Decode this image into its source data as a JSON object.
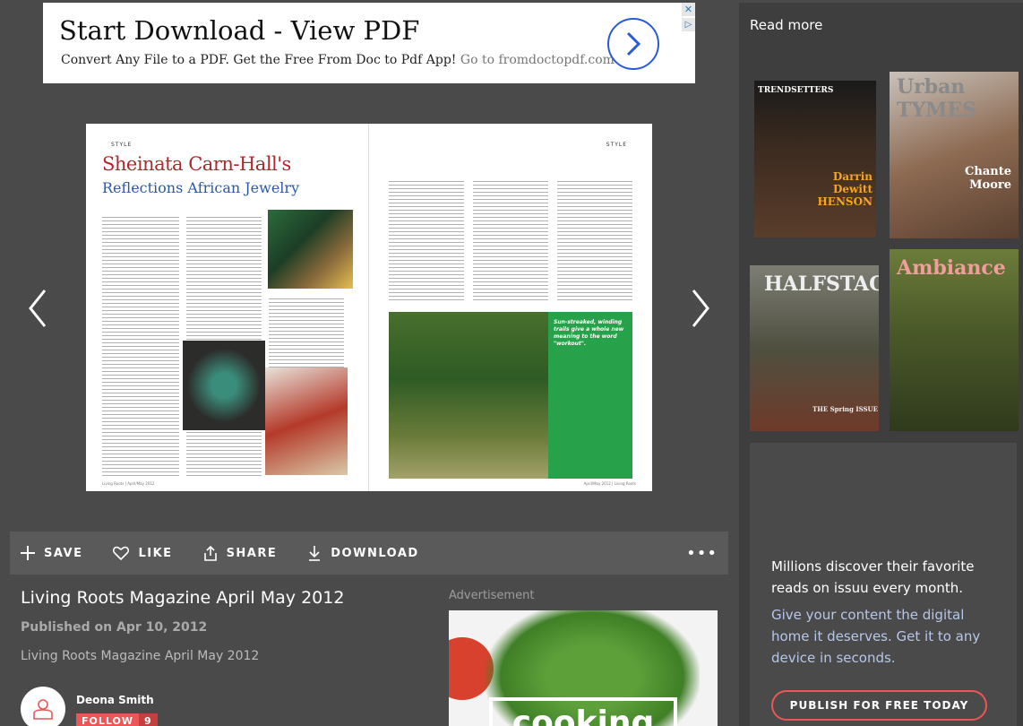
{
  "ad_top": {
    "headline": "Start Download - View PDF",
    "subtext": "Convert Any File to a PDF. Get the Free From Doc to Pdf App!",
    "link_text": "Go to fromdoctopdf.com",
    "close_glyph": "✕",
    "adchoices_glyph": "▷"
  },
  "reader": {
    "left_style": "STYLE",
    "right_style": "STYLE",
    "article_title": "Sheinata Carn-Hall's",
    "article_subtitle": "Reflections African Jewelry",
    "green_box_text": "Sun-streaked, winding trails give a whole new meaning to the word \"workout\".",
    "foot_left": "Living Roots | April/May 2012",
    "foot_right": "April/May 2012 | Living Roots"
  },
  "toolbar": {
    "save_label": "SAVE",
    "like_label": "LIKE",
    "share_label": "SHARE",
    "download_label": "DOWNLOAD",
    "more_label": "•••"
  },
  "publication": {
    "title": "Living Roots Magazine April May 2012",
    "published": "Published on Apr 10, 2012",
    "description": "Living Roots Magazine April May 2012",
    "author": "Deona Smith",
    "follow_label": "FOLLOW",
    "follow_count": "9"
  },
  "advertisement": {
    "label": "Advertisement",
    "headline": "cooking"
  },
  "sidebar": {
    "read_more": "Read more",
    "thumbs": [
      {
        "title": "TRENDSETTERS",
        "subtitle": "Darrin Dewitt HENSON"
      },
      {
        "title": "Urban TYMES",
        "subtitle": "Chante Moore"
      },
      {
        "title": "HALFSTACK",
        "subtitle": "THE Spring ISSUE"
      },
      {
        "title": "Ambiance",
        "subtitle": ""
      }
    ],
    "promo_line1": "Millions discover their favorite reads on issuu every month.",
    "promo_line2": "Give your content the digital home it deserves. Get it to any device in seconds.",
    "promo_cta": "PUBLISH FOR FREE TODAY"
  },
  "colors": {
    "accent": "#ec5656",
    "title_red": "#b2262d",
    "title_blue": "#2b5aa3",
    "green": "#27a24a"
  }
}
